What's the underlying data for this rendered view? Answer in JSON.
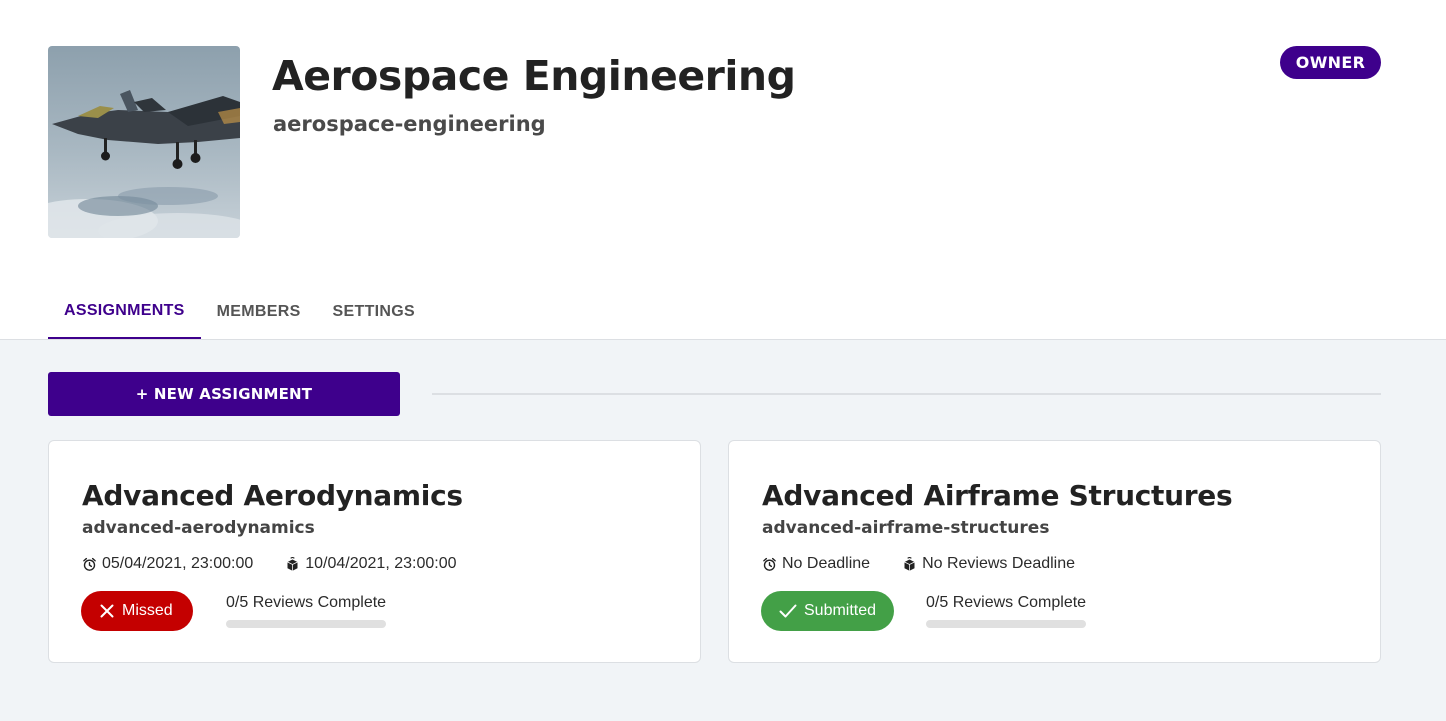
{
  "course": {
    "title": "Aerospace Engineering",
    "slug": "aerospace-engineering",
    "role": "OWNER",
    "image": "fighter-jet-photo"
  },
  "tabs": [
    {
      "label": "ASSIGNMENTS",
      "active": true
    },
    {
      "label": "MEMBERS",
      "active": false
    },
    {
      "label": "SETTINGS",
      "active": false
    }
  ],
  "actions": {
    "new_assignment_label": "+ NEW ASSIGNMENT"
  },
  "assignments": [
    {
      "title": "Advanced Aerodynamics",
      "slug": "advanced-aerodynamics",
      "deadline": "05/04/2021, 23:00:00",
      "review_deadline": "10/04/2021, 23:00:00",
      "status": "Missed",
      "status_color": "#c40000",
      "reviews_label": "0/5 Reviews Complete",
      "reviews_progress": 0
    },
    {
      "title": "Advanced Airframe Structures",
      "slug": "advanced-airframe-structures",
      "deadline": "No Deadline",
      "review_deadline": "No Reviews Deadline",
      "status": "Submitted",
      "status_color": "#43a047",
      "reviews_label": "0/5 Reviews Complete",
      "reviews_progress": 0
    }
  ],
  "colors": {
    "brand": "#3e008c",
    "background": "#f1f4f7"
  }
}
